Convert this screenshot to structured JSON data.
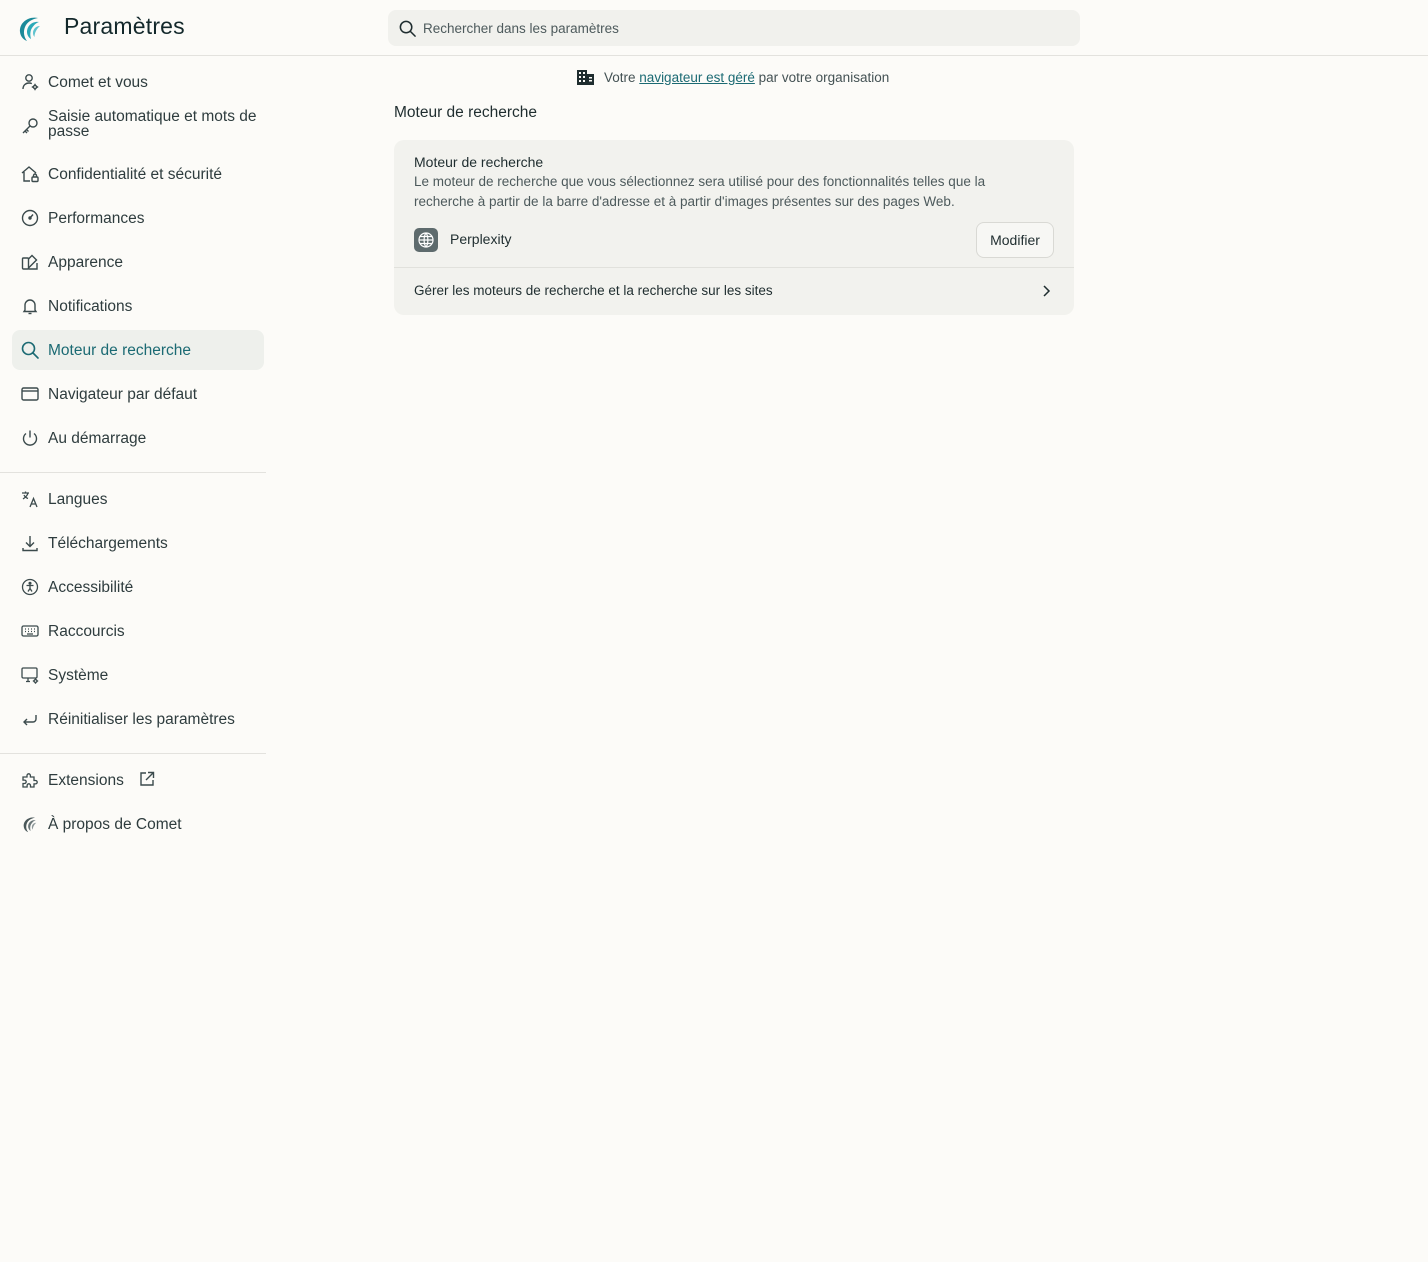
{
  "header": {
    "title": "Paramètres",
    "search_placeholder": "Rechercher dans les paramètres"
  },
  "sidebar": {
    "items": [
      {
        "label": "Comet et vous",
        "icon": "person-settings-icon"
      },
      {
        "label": "Saisie automatique et mots de passe",
        "icon": "key-icon"
      },
      {
        "label": "Confidentialité et sécurité",
        "icon": "home-lock-icon"
      },
      {
        "label": "Performances",
        "icon": "gauge-icon"
      },
      {
        "label": "Apparence",
        "icon": "palette-icon"
      },
      {
        "label": "Notifications",
        "icon": "bell-icon"
      },
      {
        "label": "Moteur de recherche",
        "icon": "search-icon",
        "active": true
      },
      {
        "label": "Navigateur par défaut",
        "icon": "browser-window-icon"
      },
      {
        "label": "Au démarrage",
        "icon": "power-icon"
      },
      {
        "label": "Langues",
        "icon": "translate-icon"
      },
      {
        "label": "Téléchargements",
        "icon": "download-icon"
      },
      {
        "label": "Accessibilité",
        "icon": "accessibility-icon"
      },
      {
        "label": "Raccourcis",
        "icon": "keyboard-icon"
      },
      {
        "label": "Système",
        "icon": "monitor-settings-icon"
      },
      {
        "label": "Réinitialiser les paramètres",
        "icon": "reset-icon"
      },
      {
        "label": "Extensions",
        "icon": "puzzle-icon"
      },
      {
        "label": "À propos de Comet",
        "icon": "comet-logo-icon"
      }
    ]
  },
  "managed_notice": {
    "prefix": "Votre",
    "link": "navigateur est géré",
    "suffix": "par votre organisation"
  },
  "main": {
    "section_title": "Moteur de recherche",
    "card": {
      "title": "Moteur de recherche",
      "description": "Le moteur de recherche que vous sélectionnez sera utilisé pour des fonctionnalités telles que la recherche à partir de la barre d'adresse et à partir d'images présentes sur des pages Web.",
      "engine_name": "Perplexity",
      "modify_label": "Modifier",
      "manage_label": "Gérer les moteurs de recherche et la recherche sur les sites"
    }
  },
  "colors": {
    "accent": "#1b6a73",
    "background": "#fcfbf8",
    "active_bg": "#eef0ec",
    "card_bg": "#f2f2ee"
  }
}
